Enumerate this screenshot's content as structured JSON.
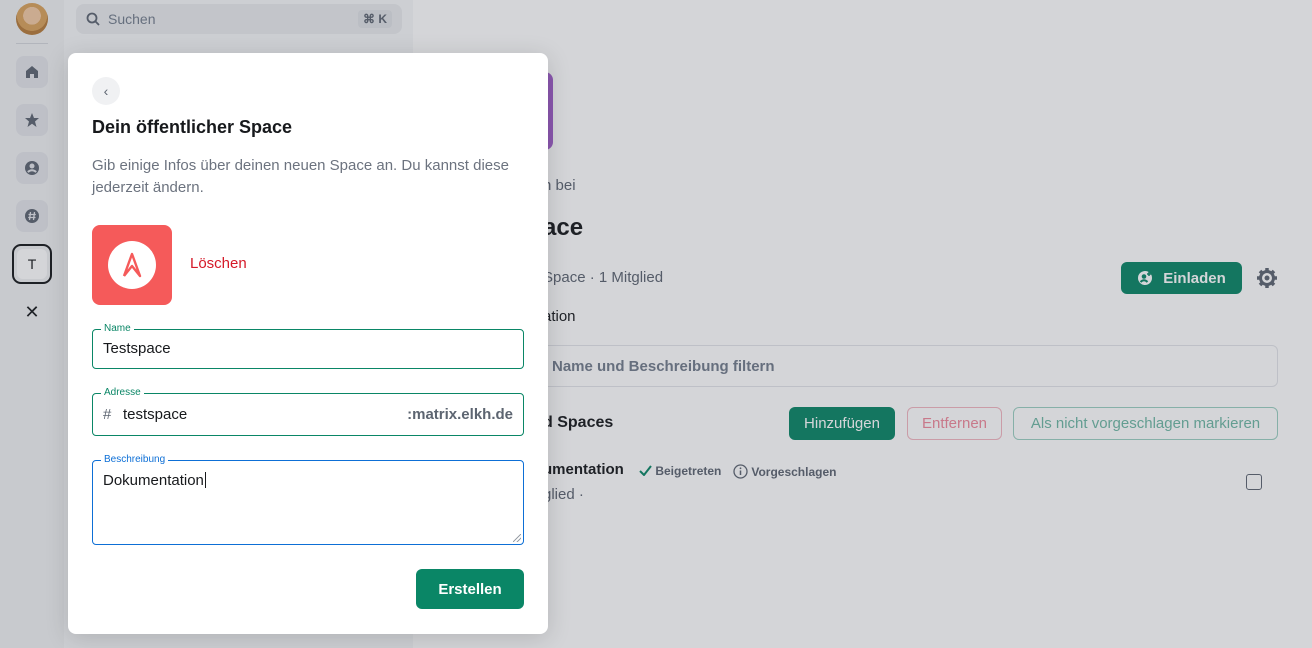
{
  "spacebar": {
    "space_t_letter": "T",
    "close_symbol": "✕"
  },
  "roomlist": {
    "search_placeholder": "Suchen",
    "search_shortcut": "⌘ K"
  },
  "main": {
    "eyebrow": "n bei",
    "title": "ace",
    "meta": "Space · 1 Mitglied",
    "invite_label": "Einladen",
    "description": "ation",
    "filter_placeholder": "Name und Beschreibung filtern",
    "rooms_heading": "d Spaces",
    "add_label": "Hinzufügen",
    "remove_label": "Entfernen",
    "not_suggested_label": "Als nicht vorgeschlagen markieren",
    "row": {
      "name": "umentation",
      "joined": "Beigetreten",
      "suggested": "Vorgeschlagen",
      "sub": "glied ·"
    }
  },
  "dialog": {
    "back_symbol": "‹",
    "title": "Dein öffentlicher Space",
    "text": "Gib einige Infos über deinen neuen Space an. Du kannst diese jederzeit ändern.",
    "delete_label": "Löschen",
    "name_label": "Name",
    "name_value": "Testspace",
    "address_label": "Adresse",
    "address_prefix": "#",
    "address_value": "testspace",
    "address_suffix": ":matrix.elkh.de",
    "description_label": "Beschreibung",
    "description_value": "Dokumentation",
    "create_label": "Erstellen"
  },
  "colors": {
    "accent": "#0a8666",
    "danger": "#d51928",
    "focus": "#0d6fd6",
    "avatar_bg": "#f55a5a"
  }
}
